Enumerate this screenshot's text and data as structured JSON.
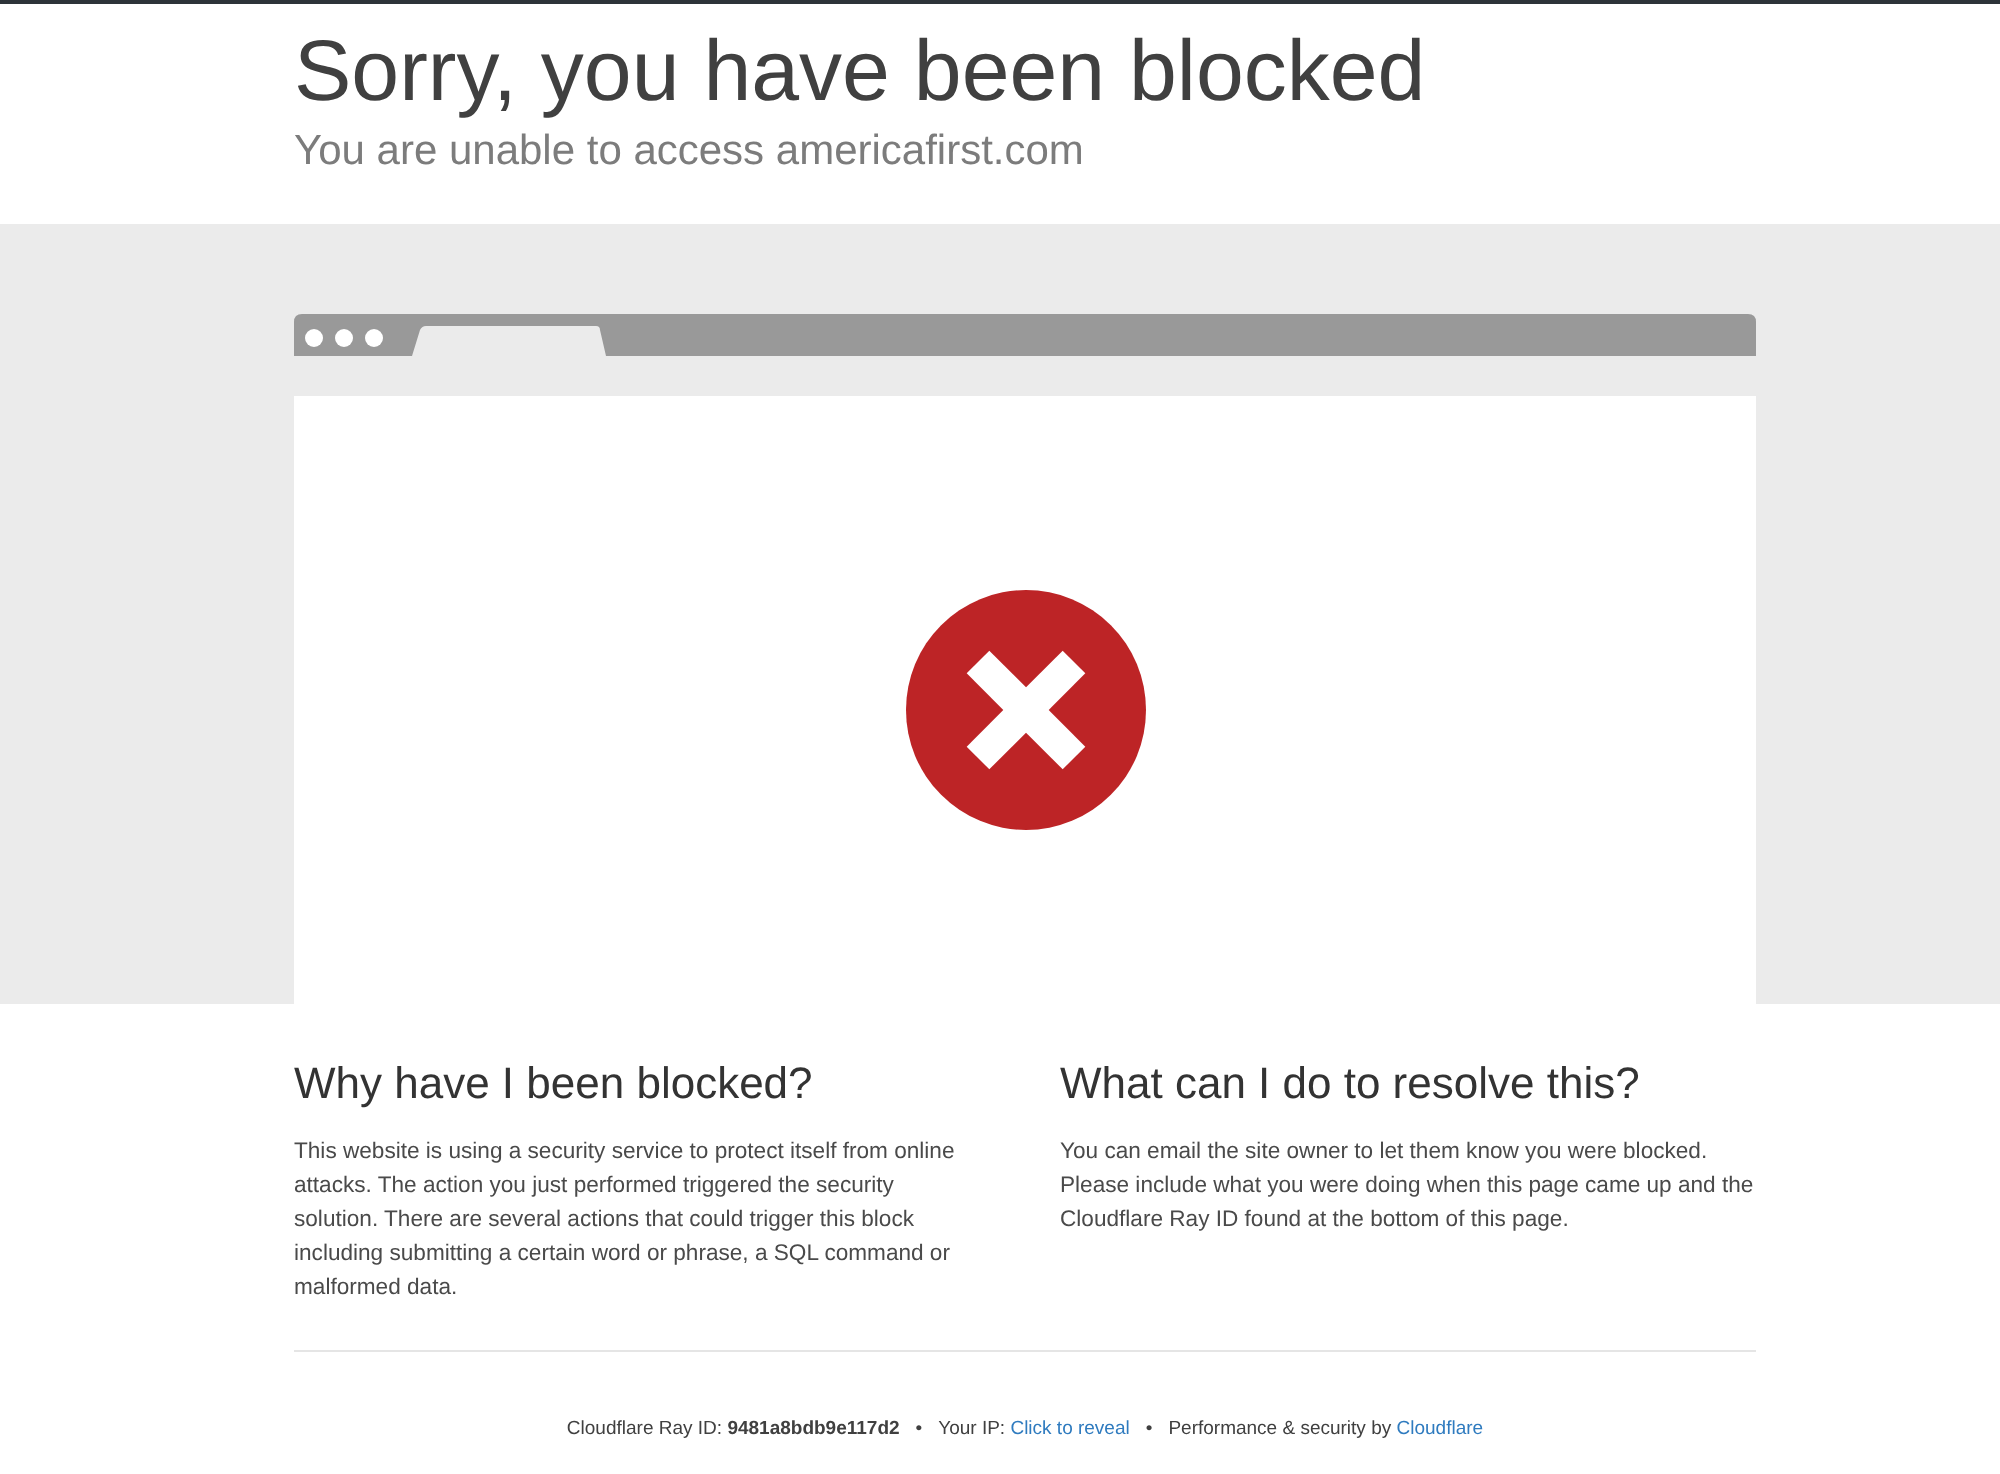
{
  "header": {
    "title": "Sorry, you have been blocked",
    "subtitle": "You are unable to access americafirst.com"
  },
  "sections": [
    {
      "heading": "Why have I been blocked?",
      "text": "This website is using a security service to protect itself from online attacks. The action you just performed triggered the security solution. There are several actions that could trigger this block including submitting a certain word or phrase, a SQL command or malformed data."
    },
    {
      "heading": "What can I do to resolve this?",
      "text": "You can email the site owner to let them know you were blocked. Please include what you were doing when this page came up and the Cloudflare Ray ID found at the bottom of this page."
    }
  ],
  "footer": {
    "items": [
      {
        "kind": "ray",
        "label": "Cloudflare Ray ID:",
        "value": "9481a8bdb9e117d2"
      },
      {
        "kind": "ip",
        "label": "Your IP:",
        "link": "Click to reveal"
      },
      {
        "kind": "credit",
        "label": "Performance & security by",
        "link": "Cloudflare"
      }
    ],
    "separators": [
      "•",
      "•"
    ]
  }
}
